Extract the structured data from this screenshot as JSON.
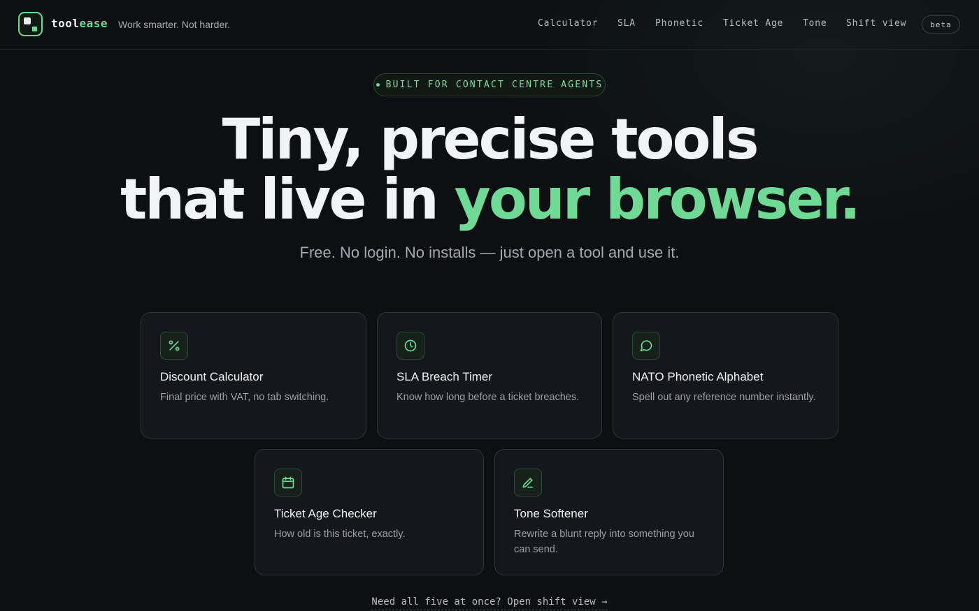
{
  "header": {
    "brand_part1": "tool",
    "brand_part2": "ease",
    "tagline": "Work smarter. Not harder.",
    "nav": [
      "Calculator",
      "SLA",
      "Phonetic",
      "Ticket Age",
      "Tone",
      "Shift view"
    ],
    "badge": "beta"
  },
  "hero": {
    "eyebrow": "BUILT FOR CONTACT CENTRE AGENTS",
    "headline_line1": "Tiny, precise tools",
    "headline_line2_plain": "that live in ",
    "headline_line2_accent": "your browser.",
    "subtitle": "Free. No login. No installs — just open a tool and use it."
  },
  "tools": [
    {
      "icon": "percent-icon",
      "title": "Discount Calculator",
      "desc": "Final price with VAT, no tab switching."
    },
    {
      "icon": "clock-icon",
      "title": "SLA Breach Timer",
      "desc": "Know how long before a ticket breaches."
    },
    {
      "icon": "chat-bubble-icon",
      "title": "NATO Phonetic Alphabet",
      "desc": "Spell out any reference number instantly."
    },
    {
      "icon": "calendar-icon",
      "title": "Ticket Age Checker",
      "desc": "How old is this ticket, exactly."
    },
    {
      "icon": "pen-icon",
      "title": "Tone Softener",
      "desc": "Rewrite a blunt reply into something you can send."
    }
  ],
  "footer": {
    "link": "Need all five at once? Open shift view →"
  },
  "colors": {
    "background": "#0d0f12",
    "accent": "#6fd996",
    "card": "#14171b"
  }
}
